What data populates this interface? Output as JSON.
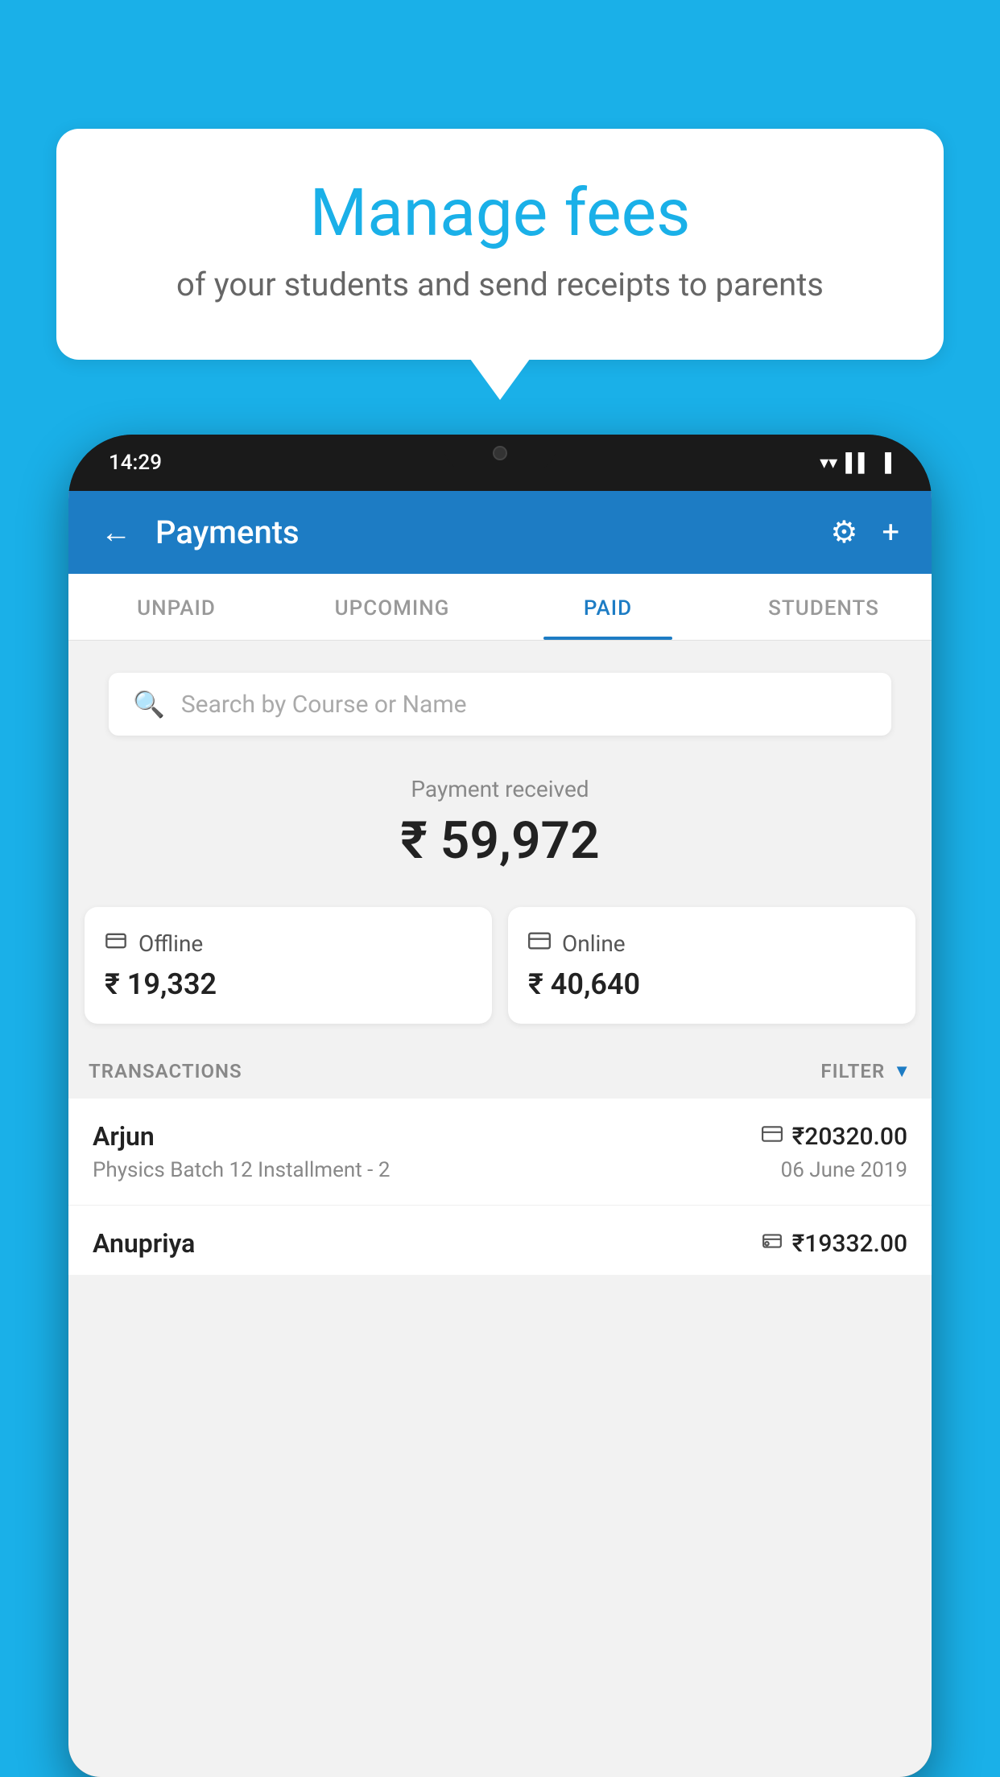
{
  "background_color": "#1ab0e8",
  "bubble": {
    "title": "Manage fees",
    "subtitle": "of your students and send receipts to parents"
  },
  "phone": {
    "status_bar": {
      "time": "14:29",
      "icons": [
        "wifi",
        "signal",
        "battery"
      ]
    },
    "header": {
      "back_label": "←",
      "title": "Payments",
      "gear_label": "⚙",
      "plus_label": "+"
    },
    "tabs": [
      {
        "label": "UNPAID",
        "active": false
      },
      {
        "label": "UPCOMING",
        "active": false
      },
      {
        "label": "PAID",
        "active": true
      },
      {
        "label": "STUDENTS",
        "active": false
      }
    ],
    "search": {
      "placeholder": "Search by Course or Name"
    },
    "payment_summary": {
      "label": "Payment received",
      "amount": "₹ 59,972",
      "offline": {
        "icon": "💳",
        "label": "Offline",
        "amount": "₹ 19,332"
      },
      "online": {
        "icon": "💳",
        "label": "Online",
        "amount": "₹ 40,640"
      }
    },
    "transactions": {
      "header_label": "TRANSACTIONS",
      "filter_label": "FILTER",
      "items": [
        {
          "name": "Arjun",
          "amount": "₹20320.00",
          "course": "Physics Batch 12 Installment - 2",
          "date": "06 June 2019",
          "payment_type": "online"
        },
        {
          "name": "Anupriya",
          "amount": "₹19332.00",
          "course": "",
          "date": "",
          "payment_type": "offline"
        }
      ]
    }
  }
}
